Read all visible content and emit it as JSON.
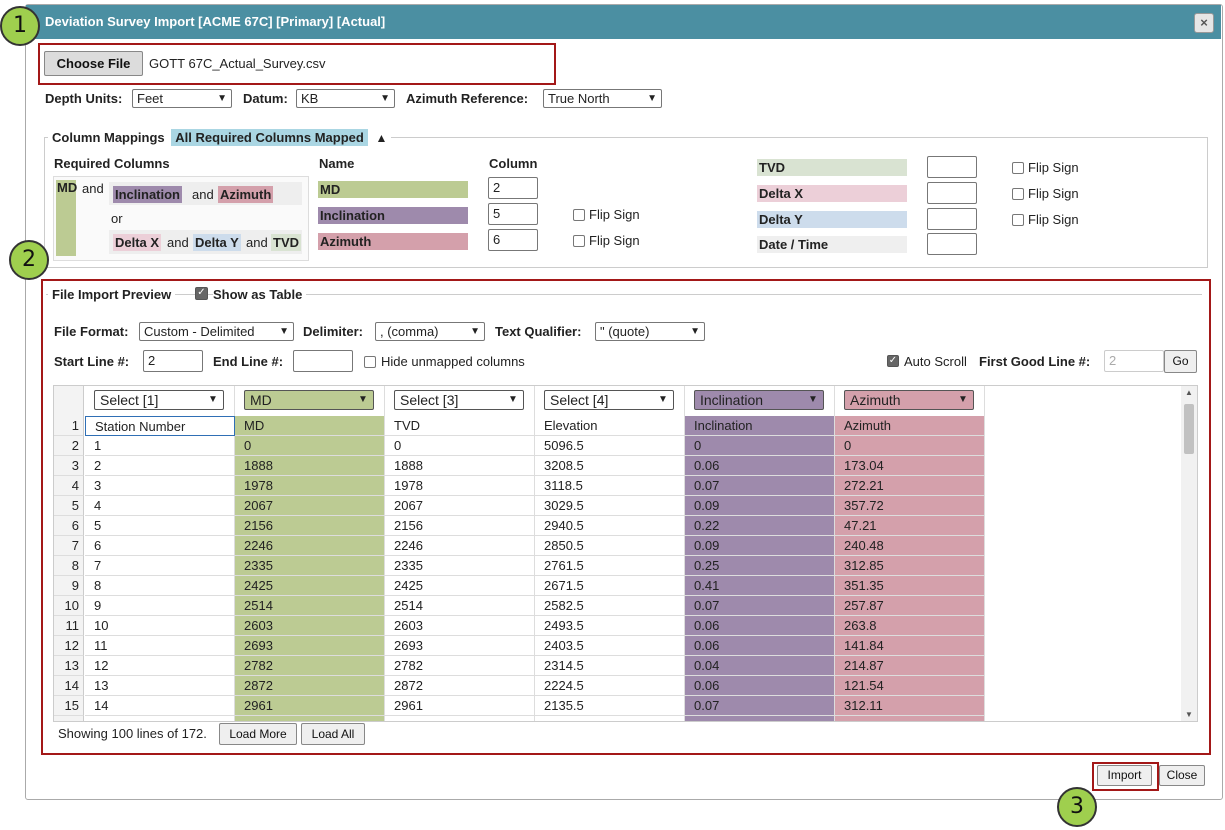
{
  "window": {
    "title": "Deviation Survey Import [ACME 67C] [Primary] [Actual]",
    "close_glyph": "×"
  },
  "badges": [
    "1",
    "2",
    "3"
  ],
  "file": {
    "choose_label": "Choose File",
    "file_name": "GOTT 67C_Actual_Survey.csv"
  },
  "settings": {
    "depth_units_label": "Depth Units:",
    "depth_units_value": "Feet",
    "datum_label": "Datum:",
    "datum_value": "KB",
    "azimuth_ref_label": "Azimuth Reference:",
    "azimuth_ref_value": "True North"
  },
  "mappings": {
    "legend": "Column Mappings",
    "status": "All Required Columns Mapped",
    "required_header": "Required Columns",
    "name_header": "Name",
    "column_header": "Column",
    "req_md": "MD",
    "req_and1": "and",
    "req_inc": "Inclination",
    "req_and2": "and",
    "req_az": "Azimuth",
    "req_or": "or",
    "req_dx": "Delta X",
    "req_and3": "and",
    "req_dy": "Delta Y",
    "req_and4": "and",
    "req_tvd": "TVD",
    "left_rows": [
      {
        "name": "MD",
        "column": "2",
        "flip": false
      },
      {
        "name": "Inclination",
        "column": "5",
        "flip": true
      },
      {
        "name": "Azimuth",
        "column": "6",
        "flip": true
      }
    ],
    "right_rows": [
      {
        "name": "TVD",
        "column": "",
        "flip": true
      },
      {
        "name": "Delta X",
        "column": "",
        "flip": true
      },
      {
        "name": "Delta Y",
        "column": "",
        "flip": true
      },
      {
        "name": "Date / Time",
        "column": "",
        "flip": false
      }
    ],
    "flip_label": "Flip Sign"
  },
  "preview": {
    "legend": "File Import Preview",
    "show_table_label": "Show as Table",
    "file_format_label": "File Format:",
    "file_format_value": "Custom - Delimited",
    "delimiter_label": "Delimiter:",
    "delimiter_value": ", (comma)",
    "qualifier_label": "Text Qualifier:",
    "qualifier_value": "\" (quote)",
    "start_line_label": "Start Line #:",
    "start_line_value": "2",
    "end_line_label": "End Line #:",
    "end_line_value": "",
    "hide_unmapped_label": "Hide unmapped columns",
    "auto_scroll_label": "Auto Scroll",
    "first_good_label": "First Good Line #:",
    "first_good_value": "2",
    "go_label": "Go",
    "showing_text": "Showing 100 lines of 172.",
    "load_more": "Load More",
    "load_all": "Load All"
  },
  "grid": {
    "column_selects": [
      "Select [1]",
      "MD",
      "Select [3]",
      "Select [4]",
      "Inclination",
      "Azimuth"
    ],
    "rows": [
      [
        "1",
        "Station Number",
        "MD",
        "TVD",
        "Elevation",
        "Inclination",
        "Azimuth"
      ],
      [
        "2",
        "1",
        "0",
        "0",
        "5096.5",
        "0",
        "0"
      ],
      [
        "3",
        "2",
        "1888",
        "1888",
        "3208.5",
        "0.06",
        "173.04"
      ],
      [
        "4",
        "3",
        "1978",
        "1978",
        "3118.5",
        "0.07",
        "272.21"
      ],
      [
        "5",
        "4",
        "2067",
        "2067",
        "3029.5",
        "0.09",
        "357.72"
      ],
      [
        "6",
        "5",
        "2156",
        "2156",
        "2940.5",
        "0.22",
        "47.21"
      ],
      [
        "7",
        "6",
        "2246",
        "2246",
        "2850.5",
        "0.09",
        "240.48"
      ],
      [
        "8",
        "7",
        "2335",
        "2335",
        "2761.5",
        "0.25",
        "312.85"
      ],
      [
        "9",
        "8",
        "2425",
        "2425",
        "2671.5",
        "0.41",
        "351.35"
      ],
      [
        "10",
        "9",
        "2514",
        "2514",
        "2582.5",
        "0.07",
        "257.87"
      ],
      [
        "11",
        "10",
        "2603",
        "2603",
        "2493.5",
        "0.06",
        "263.8"
      ],
      [
        "12",
        "11",
        "2693",
        "2693",
        "2403.5",
        "0.06",
        "141.84"
      ],
      [
        "13",
        "12",
        "2782",
        "2782",
        "2314.5",
        "0.04",
        "214.87"
      ],
      [
        "14",
        "13",
        "2872",
        "2872",
        "2224.5",
        "0.06",
        "121.54"
      ],
      [
        "15",
        "14",
        "2961",
        "2961",
        "2135.5",
        "0.07",
        "312.11"
      ]
    ]
  },
  "footer": {
    "import_label": "Import",
    "close_label": "Close"
  },
  "colors": {
    "titlebar": "#4b8fa2",
    "md": "#bccb93",
    "inclination": "#9e8aac",
    "azimuth": "#d4a0ab",
    "highlight_box": "#a31818",
    "badge": "#9fcf4e"
  }
}
